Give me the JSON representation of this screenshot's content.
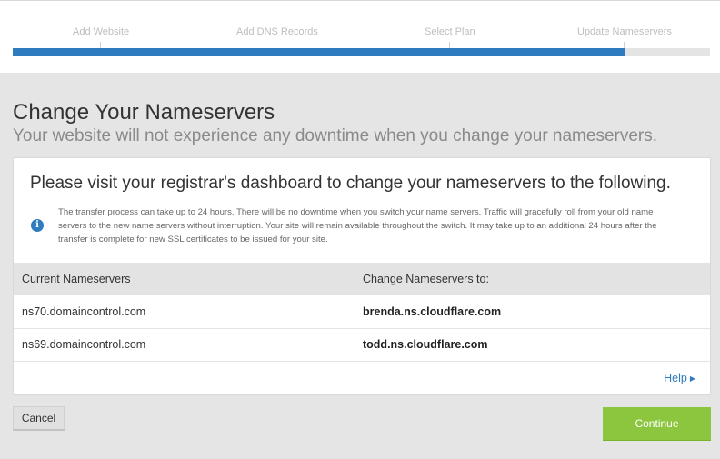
{
  "progress": {
    "steps": [
      {
        "label": "Add Website"
      },
      {
        "label": "Add DNS Records"
      },
      {
        "label": "Select Plan"
      },
      {
        "label": "Update Nameservers"
      }
    ],
    "completion_fraction": 0.877,
    "colors": {
      "fill": "#2f7bbf",
      "track": "#e4e4e4"
    }
  },
  "page": {
    "title": "Change Your Nameservers",
    "subtitle": "Your website will not experience any downtime when you change your nameservers."
  },
  "card": {
    "heading": "Please visit your registrar's dashboard to change your nameservers to the following.",
    "info_icon": "info-icon",
    "info_text": "The transfer process can take up to 24 hours. There will be no downtime when you switch your name servers. Traffic will gracefully roll from your old name servers to the new name servers without interruption. Your site will remain available throughout the switch. It may take up to an additional 24 hours after the transfer is complete for new SSL certificates to be issued for your site.",
    "table": {
      "headers": [
        "Current Nameservers",
        "Change Nameservers to:"
      ],
      "rows": [
        [
          "ns70.domaincontrol.com",
          "brenda.ns.cloudflare.com"
        ],
        [
          "ns69.domaincontrol.com",
          "todd.ns.cloudflare.com"
        ]
      ]
    },
    "help_label": "Help",
    "help_icon": "caret-right-icon"
  },
  "actions": {
    "cancel_label": "Cancel",
    "continue_label": "Continue",
    "continue_color": "#8cc63f"
  }
}
